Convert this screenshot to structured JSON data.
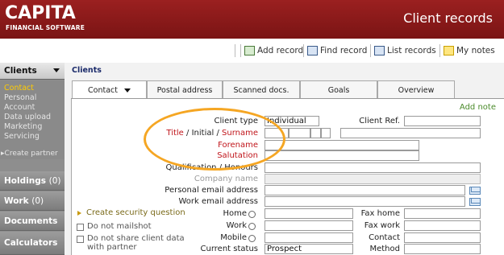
{
  "header": {
    "logo": "CAPITA",
    "logo_sub": "FINANCIAL SOFTWARE",
    "title": "Client records"
  },
  "toolbar": {
    "buttons": [
      {
        "label": "Add record",
        "icon": "add-record-icon"
      },
      {
        "label": "Find record",
        "icon": "find-record-icon"
      },
      {
        "label": "List records",
        "icon": "list-records-icon"
      },
      {
        "label": "My notes",
        "icon": "notes-icon"
      }
    ]
  },
  "sidebar": {
    "section": "Clients",
    "items": [
      "Contact",
      "Personal",
      "Account",
      "Data upload",
      "Marketing",
      "Servicing"
    ],
    "active_item": "Contact",
    "create_partner": "Create partner",
    "holdings": "Holdings",
    "holdings_count": "(0)",
    "work": "Work",
    "work_count": "(0)",
    "documents": "Documents",
    "calculators": "Calculators"
  },
  "breadcrumb": "Clients",
  "tabs": [
    {
      "label": "Contact",
      "active": true
    },
    {
      "label": "Postal address"
    },
    {
      "label": "Scanned docs."
    },
    {
      "label": "Goals"
    },
    {
      "label": "Overview"
    }
  ],
  "form": {
    "add_note": "Add note",
    "client_type_label": "Client type",
    "client_type_value": "Individual",
    "client_ref_label": "Client Ref.",
    "client_ref_value": "",
    "title_label": "Title",
    "initial_label": "Initial",
    "surname_label": "Surname",
    "slash": "/",
    "forename_label": "Forename",
    "salutation_label": "Salutation",
    "qualification_label": "Qualification / Honours",
    "company_name_label": "Company name",
    "personal_email_label": "Personal email address",
    "work_email_label": "Work email address",
    "security_question": "Create security question",
    "do_not_mailshot": "Do not mailshot",
    "do_not_share_1": "Do not share client data",
    "do_not_share_2": "with partner",
    "home_label": "Home",
    "work_label": "Work",
    "mobile_label": "Mobile",
    "current_status_label": "Current status",
    "current_status_value": "Prospect",
    "fax_home_label": "Fax home",
    "fax_work_label": "Fax work",
    "contact_label": "Contact",
    "method_label": "Method"
  },
  "colors": {
    "header_bg": "#8a1a1a",
    "sidebar_bg": "#8e8e8e",
    "active_item": "#ffcc00",
    "required_label": "#c0141a",
    "highlight": "#f5a623",
    "add_note": "#4a8a2a"
  }
}
